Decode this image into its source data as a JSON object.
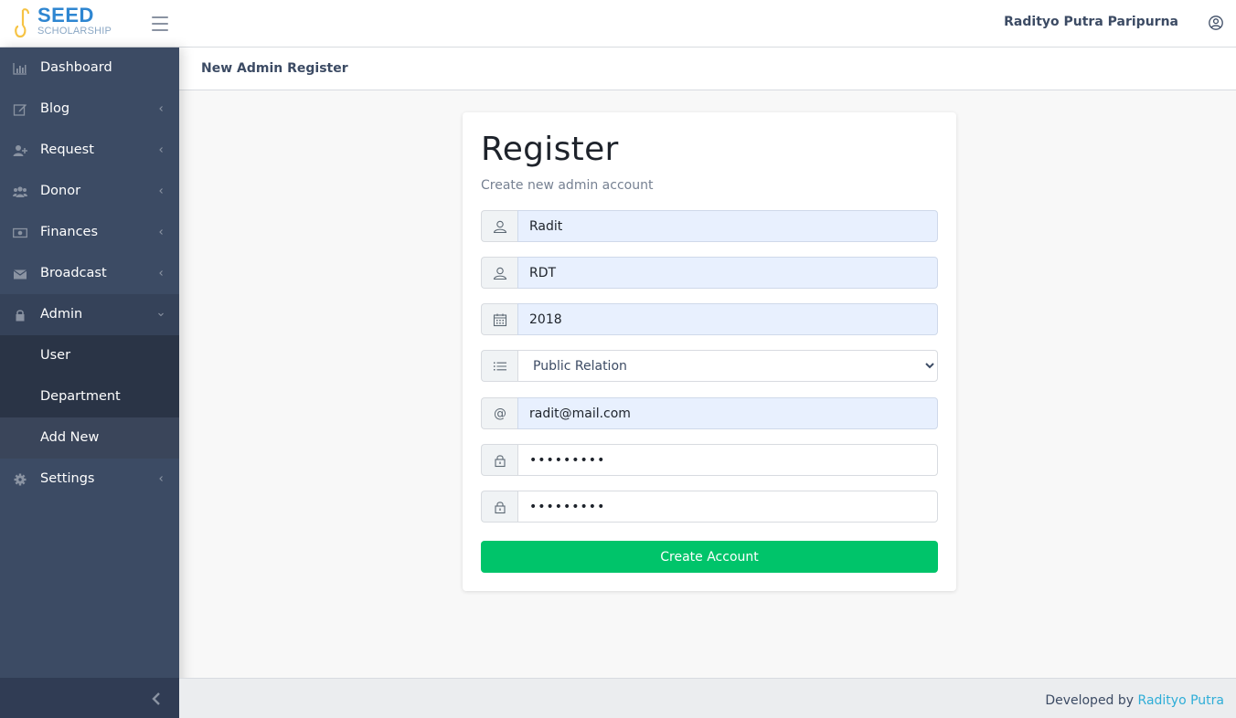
{
  "brand": {
    "name": "SEED",
    "tagline": "SCHOLARSHIP",
    "color": "#2e86d1",
    "accent": "#f6c344"
  },
  "header": {
    "user_name": "Radityo Putra Paripurna",
    "user_icon": "user-circle-icon",
    "menu_icon": "hamburger-icon"
  },
  "subheader": {
    "title": "New Admin Register"
  },
  "sidebar": {
    "items": [
      {
        "label": "Dashboard",
        "icon": "bar-chart-icon"
      },
      {
        "label": "Blog",
        "icon": "edit-icon"
      },
      {
        "label": "Request",
        "icon": "user-plus-icon"
      },
      {
        "label": "Donor",
        "icon": "users-icon"
      },
      {
        "label": "Finances",
        "icon": "money-icon"
      },
      {
        "label": "Broadcast",
        "icon": "envelope-icon"
      },
      {
        "label": "Admin",
        "icon": "lock-icon"
      },
      {
        "label": "Settings",
        "icon": "gear-icon"
      }
    ],
    "admin_sub": [
      {
        "label": "User"
      },
      {
        "label": "Department"
      },
      {
        "label": "Add New"
      }
    ],
    "colors": {
      "bg": "#3c4b64",
      "sub_bg": "#2a3446"
    }
  },
  "form": {
    "title": "Register",
    "subtitle": "Create new admin account",
    "name_value": "Radit",
    "nickname_value": "RDT",
    "year_value": "2018",
    "department_value": "Public Relation",
    "at_symbol": "@",
    "email_value": "radit@mail.com",
    "password_value": "•••••••••",
    "confirm_value": "•••••••••",
    "submit_label": "Create Account",
    "submit_color": "#00c46a"
  },
  "footer": {
    "prefix": "Developed by",
    "author": "Radityo Putra"
  }
}
